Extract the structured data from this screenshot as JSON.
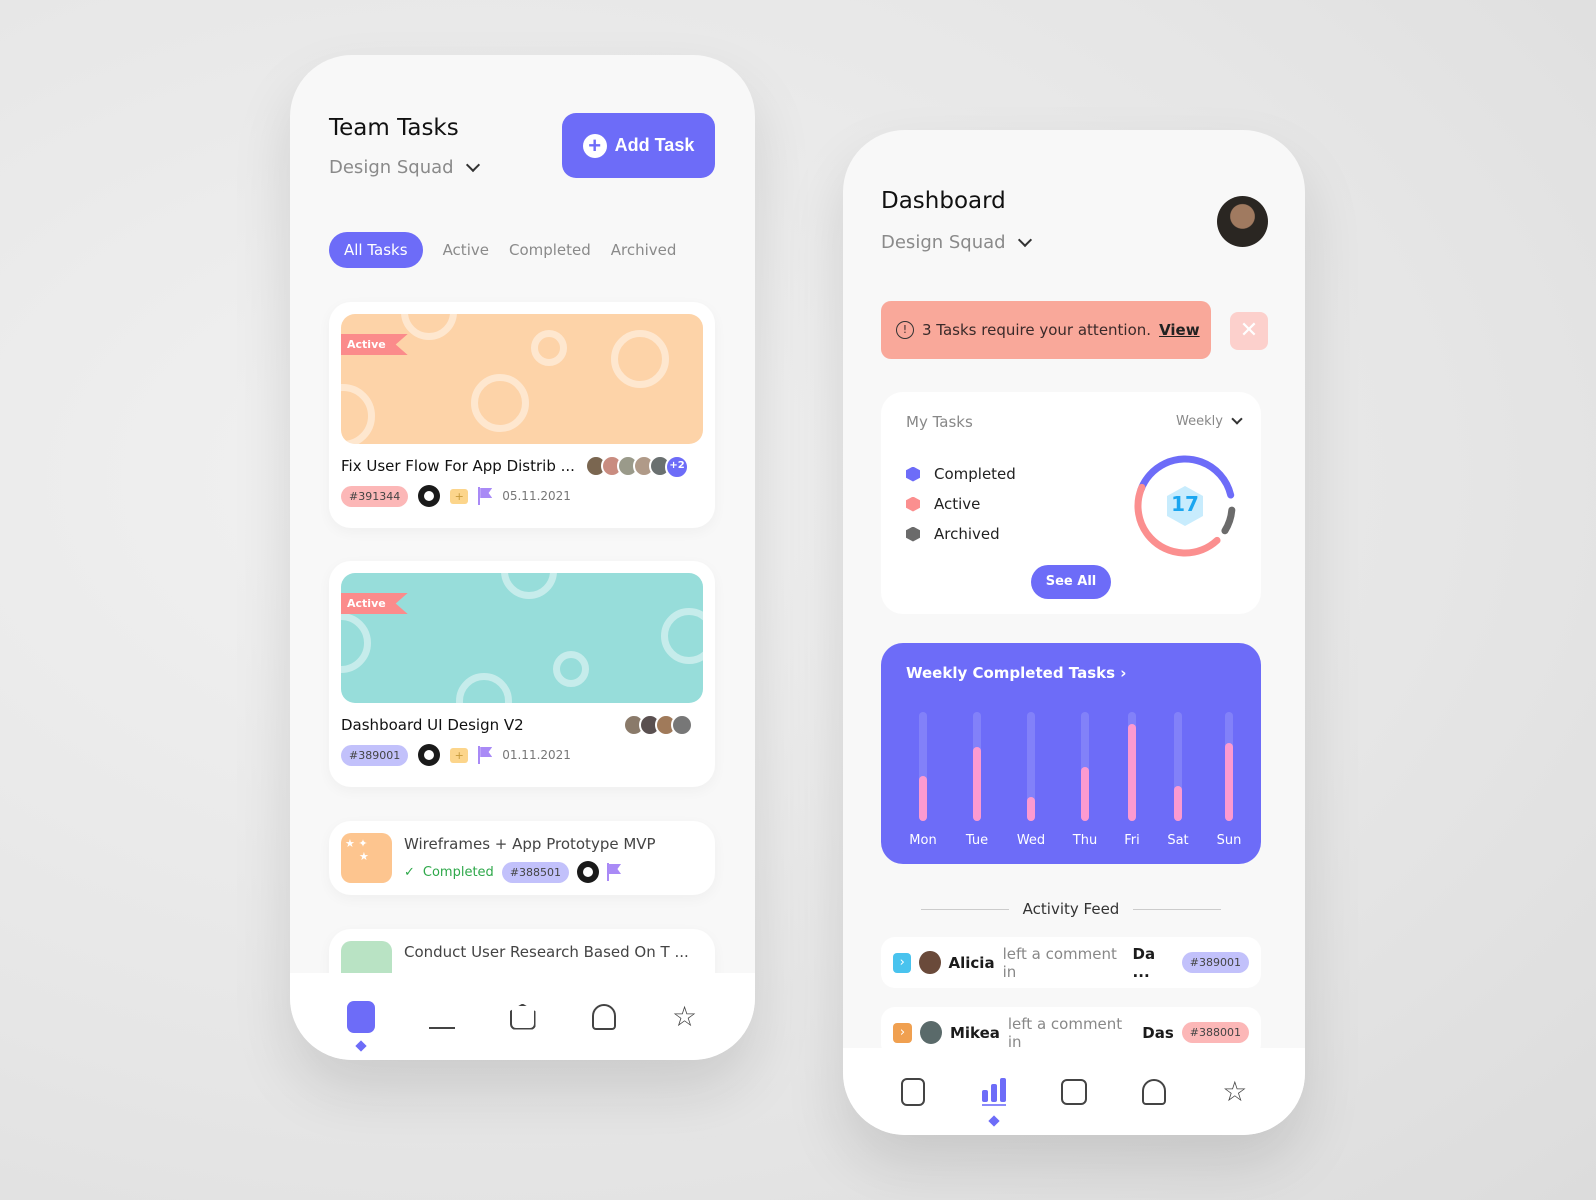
{
  "left_screen": {
    "title": "Team Tasks",
    "team": "Design Squad",
    "add_task_label": "Add Task",
    "tabs": [
      {
        "label": "All Tasks",
        "active": true
      },
      {
        "label": "Active"
      },
      {
        "label": "Completed"
      },
      {
        "label": "Archived"
      }
    ],
    "tasks": [
      {
        "status_ribbon": "Active",
        "title": "Fix User Flow For App Distrib ...",
        "id": "#391344",
        "date": "05.11.2021",
        "extra_members": "+2",
        "banner_color": "#fdd3a8"
      },
      {
        "status_ribbon": "Active",
        "title": "Dashboard UI Design V2",
        "id": "#389001",
        "date": "01.11.2021",
        "banner_color": "#97ddda"
      },
      {
        "title": "Wireframes + App Prototype MVP",
        "status": "Completed",
        "id": "#388501",
        "thumb_color": "#fdc58f"
      },
      {
        "title": "Conduct User Research Based On T ...",
        "thumb_color": "#b9e3c4"
      }
    ],
    "nav": [
      "tasks-icon",
      "chart-icon",
      "home-icon",
      "bell-icon",
      "star-icon"
    ],
    "nav_active": "tasks-icon"
  },
  "right_screen": {
    "title": "Dashboard",
    "team": "Design Squad",
    "alert": {
      "text": "3 Tasks require your attention.",
      "link": "View"
    },
    "my_tasks": {
      "title": "My Tasks",
      "period": "Weekly",
      "legend": [
        {
          "label": "Completed",
          "color": "#6d6cf8"
        },
        {
          "label": "Active",
          "color": "#fb8f8f"
        },
        {
          "label": "Archived",
          "color": "#6b6b6b"
        }
      ],
      "total": "17",
      "see_all": "See All"
    },
    "weekly": {
      "title": "Weekly Completed Tasks",
      "days": [
        "Mon",
        "Tue",
        "Wed",
        "Thu",
        "Fri",
        "Sat",
        "Sun"
      ],
      "fill": [
        0.41,
        0.68,
        0.22,
        0.5,
        0.89,
        0.32,
        0.72
      ]
    },
    "activity_title": "Activity Feed",
    "feed": [
      {
        "name": "Alicia",
        "text": "left a comment in",
        "target": "Da ...",
        "id": "#389001"
      },
      {
        "name": "Mikea",
        "text": "left a comment in",
        "target": "Das",
        "id": "#388001"
      }
    ],
    "nav_active": "chart-icon"
  },
  "colors": {
    "accent": "#6d6cf8",
    "alert": "#f9a89a"
  }
}
